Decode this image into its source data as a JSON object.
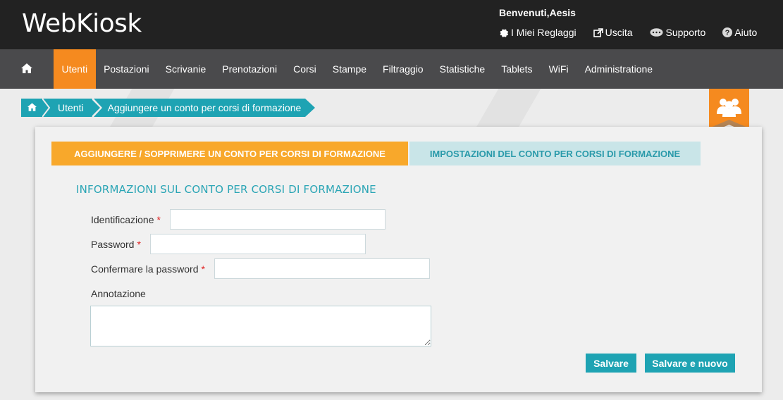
{
  "header": {
    "logo": "WebKiosk",
    "welcome": "Benvenuti,Aesis",
    "links": [
      {
        "label": "I Miei Reglaggi",
        "icon": "gear-icon"
      },
      {
        "label": "Uscita",
        "icon": "external-link-icon"
      },
      {
        "label": "Supporto",
        "icon": "chat-bubble-icon"
      },
      {
        "label": "Aiuto",
        "icon": "question-circle-icon"
      }
    ]
  },
  "nav": {
    "home_icon": "home-icon",
    "items": [
      {
        "label": "Utenti",
        "active": true
      },
      {
        "label": "Postazioni"
      },
      {
        "label": "Scrivanie"
      },
      {
        "label": "Prenotazioni"
      },
      {
        "label": "Corsi"
      },
      {
        "label": "Stampe"
      },
      {
        "label": "Filtraggio"
      },
      {
        "label": "Statistiche"
      },
      {
        "label": "Tablets"
      },
      {
        "label": "WiFi"
      },
      {
        "label": "Administratione"
      }
    ]
  },
  "breadcrumb": {
    "home_icon": "home-icon",
    "items": [
      "Utenti",
      "Aggiungere un conto per corsi di formazione"
    ]
  },
  "badge": {
    "icon": "users-group-icon"
  },
  "tabs": [
    {
      "label": "AGGIUNGERE / SOPPRIMERE UN CONTO PER CORSI DI FORMAZIONE",
      "active": true
    },
    {
      "label": "IMPOSTAZIONI DEL CONTO PER CORSI DI FORMAZIONE",
      "active": false
    }
  ],
  "form": {
    "section_title": "INFORMAZIONI SUL CONTO PER CORSI DI FORMAZIONE",
    "required_mark": "*",
    "fields": [
      {
        "label": "Identificazione",
        "value": "",
        "required": true
      },
      {
        "label": "Password",
        "value": "",
        "required": true
      },
      {
        "label": "Confermare la password",
        "value": "",
        "required": true
      },
      {
        "label": "Annotazione",
        "value": "",
        "required": false
      }
    ],
    "buttons": {
      "save": "Salvare",
      "save_new": "Salvare e nuovo"
    }
  },
  "colors": {
    "topbar": "#222222",
    "nav": "#4a4a4c",
    "accent_orange": "#f58a1f",
    "tab_active": "#f8a82b",
    "teal": "#1ea3b3",
    "tab_inactive": "#c9e5e8",
    "required": "#e02020"
  }
}
